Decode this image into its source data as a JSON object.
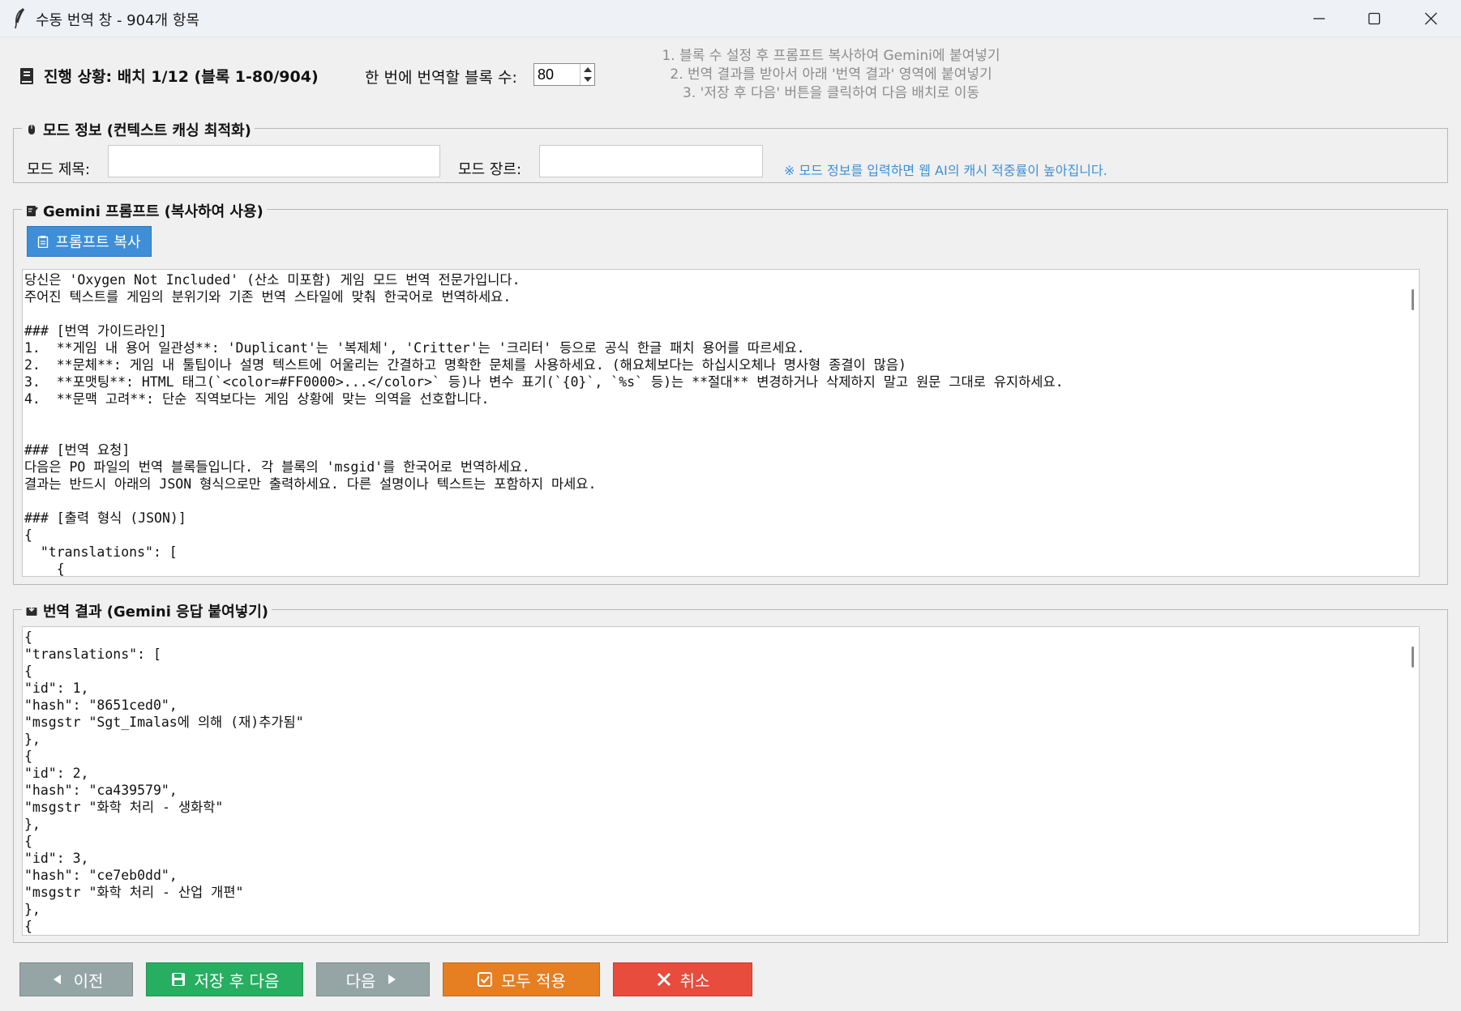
{
  "window": {
    "title": "수동 번역 창 - 904개 항목",
    "icons": {
      "app": "feather-pen-icon",
      "minimize": "minimize-icon",
      "maximize": "maximize-icon",
      "close": "close-icon"
    }
  },
  "header": {
    "progress_text": "진행 상황: 배치 1/12 (블록 1-80/904)",
    "blocks_label": "한 번에 번역할 블록 수:",
    "blocks_value": "80",
    "instructions": [
      "1. 블록 수 설정 후 프롬프트 복사하여 Gemini에 붙여넣기",
      "2. 번역 결과를 받아서 아래 '번역 결과' 영역에 붙여넣기",
      "3. '저장 후 다음' 버튼을 클릭하여 다음 배치로 이동"
    ]
  },
  "mod_info": {
    "legend": "모드 정보 (컨텍스트 캐싱 최적화)",
    "title_label": "모드 제목:",
    "title_value": "",
    "genre_label": "모드 장르:",
    "genre_value": "",
    "hint": "※ 모드 정보를 입력하면 웹 AI의 캐시 적중률이 높아집니다."
  },
  "prompt": {
    "legend": "Gemini 프롬프트 (복사하여 사용)",
    "copy_button": "프롬프트 복사",
    "text": "당신은 'Oxygen Not Included' (산소 미포함) 게임 모드 번역 전문가입니다.\n주어진 텍스트를 게임의 분위기와 기존 번역 스타일에 맞춰 한국어로 번역하세요.\n\n### [번역 가이드라인]\n1.  **게임 내 용어 일관성**: 'Duplicant'는 '복제체', 'Critter'는 '크리터' 등으로 공식 한글 패치 용어를 따르세요.\n2.  **문체**: 게임 내 툴팁이나 설명 텍스트에 어울리는 간결하고 명확한 문체를 사용하세요. (해요체보다는 하십시오체나 명사형 종결이 많음)\n3.  **포맷팅**: HTML 태그(`<color=#FF0000>...</color>` 등)나 변수 표기(`{0}`, `%s` 등)는 **절대** 변경하거나 삭제하지 말고 원문 그대로 유지하세요.\n4.  **문맥 고려**: 단순 직역보다는 게임 상황에 맞는 의역을 선호합니다.\n\n\n### [번역 요청]\n다음은 PO 파일의 번역 블록들입니다. 각 블록의 'msgid'를 한국어로 번역하세요.\n결과는 반드시 아래의 JSON 형식으로만 출력하세요. 다른 설명이나 텍스트는 포함하지 마세요.\n\n### [출력 형식 (JSON)]\n{\n  \"translations\": [\n    {"
  },
  "result": {
    "legend": "번역 결과 (Gemini 응답 붙여넣기)",
    "text": "{\n\"translations\": [\n{\n\"id\": 1,\n\"hash\": \"8651ced0\",\n\"msgstr \"Sgt_Imalas에 의해 (재)추가됨\"\n},\n{\n\"id\": 2,\n\"hash\": \"ca439579\",\n\"msgstr \"화학 처리 - 생화학\"\n},\n{\n\"id\": 3,\n\"hash\": \"ce7eb0dd\",\n\"msgstr \"화학 처리 - 산업 개편\"\n},\n{"
  },
  "buttons": {
    "prev": "이전",
    "save_next": "저장 후 다음",
    "next": "다음",
    "apply_all": "모두 적용",
    "cancel": "취소"
  },
  "colors": {
    "copy_button": "#3e8fd8",
    "prev_next": "#95a5a6",
    "save_next": "#27ae60",
    "apply_all": "#e67e22",
    "cancel": "#e74c3c",
    "hint": "#3a90d8"
  }
}
